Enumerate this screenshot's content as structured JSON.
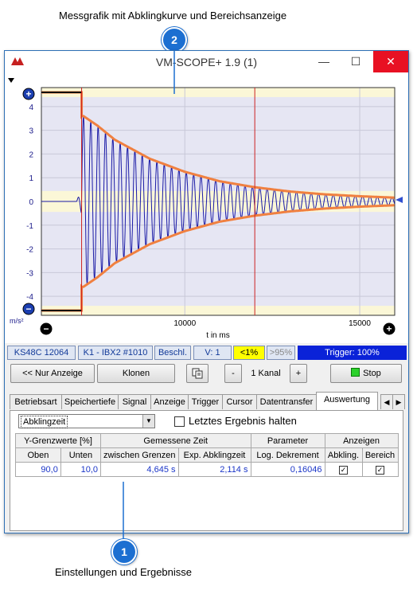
{
  "annotations": {
    "top_caption": "Messgrafik mit Abklingkurve und Bereichsanzeige",
    "top_number": "2",
    "bottom_caption": "Einstellungen und Ergebnisse",
    "bottom_number": "1"
  },
  "window": {
    "title": "VM-SCOPE+ 1.9 (1)",
    "minimize": "—",
    "maximize": "☐",
    "close": "✕"
  },
  "chart_data": {
    "type": "line",
    "xlabel": "t in ms",
    "ylabel": "m/s²",
    "x_ticks": [
      "10000",
      "15000"
    ],
    "y_ticks": [
      "4",
      "3",
      "2",
      "1",
      "0",
      "-1",
      "-2",
      "-3",
      "-4"
    ],
    "xlim": [
      5900,
      16000
    ],
    "ylim": [
      -4.8,
      4.8
    ],
    "band_upper": [
      4.4,
      4.8
    ],
    "band_lower": [
      -4.8,
      -4.4
    ],
    "band_zero": [
      -0.44,
      0.44
    ],
    "cursor_x": 12000,
    "colors": {
      "signal": "#1a1aa6",
      "envelope": "#f08040",
      "cursor": "#cc2222",
      "band": "#fbf7d7",
      "plot_bg": "#e6e6f3"
    },
    "series": [
      {
        "values_description": "decaying oscillation",
        "x": [
          7000,
          7100,
          7500,
          8000,
          9000,
          10000,
          11000,
          12000,
          13000,
          14000,
          15000,
          16000
        ],
        "y": [
          0,
          3.6,
          3.2,
          2.6,
          1.8,
          1.25,
          0.85,
          0.6,
          0.42,
          0.3,
          0.22,
          0.16
        ]
      }
    ]
  },
  "status": {
    "device": "KS48C 12064",
    "channel": "K1 - IBX2 #1010",
    "mode": "Beschl.",
    "v": "V: 1",
    "lt": "<1%",
    "gt": ">95%",
    "trigger": "Trigger: 100%"
  },
  "toolbar": {
    "nur_anzeige": "<< Nur Anzeige",
    "klonen": "Klonen",
    "minus": "-",
    "kanal": "1 Kanal",
    "plus": "+",
    "stop": "Stop"
  },
  "tabs": [
    "Betriebsart",
    "Speichertiefe",
    "Signal",
    "Anzeige",
    "Trigger",
    "Cursor",
    "Datentransfer",
    "Auswertung"
  ],
  "tab_active": "Auswertung",
  "panel": {
    "mode_select": "Abklingzeit",
    "hold_label": "Letztes Ergebnis halten",
    "group_headers": [
      "Y-Grenzwerte [%]",
      "Gemessene Zeit",
      "Parameter",
      "Anzeigen"
    ],
    "col_headers": [
      "Oben",
      "Unten",
      "zwischen Grenzen",
      "Exp. Abklingzeit",
      "Log. Dekrement",
      "Abkling.",
      "Bereich"
    ],
    "values": {
      "oben": "90,0",
      "unten": "10,0",
      "zwischen": "4,645 s",
      "exp": "2,114 s",
      "logdek": "0,16046",
      "abkling": "✓",
      "bereich": "✓"
    }
  }
}
